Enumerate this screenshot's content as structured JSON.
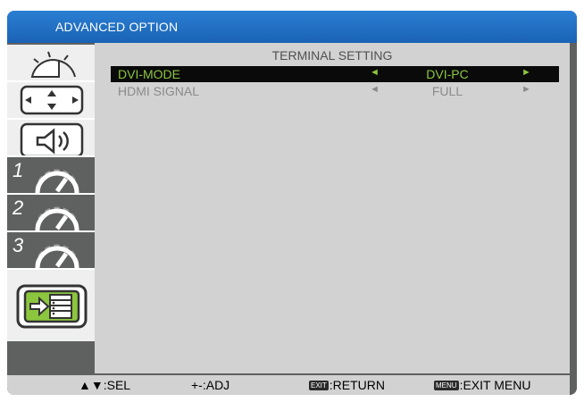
{
  "window": {
    "title": "ADVANCED OPTION"
  },
  "sidebar": {
    "items": [
      {
        "icon": "picture-icon"
      },
      {
        "icon": "screen-icon"
      },
      {
        "icon": "audio-icon"
      },
      {
        "icon": "config-1-icon",
        "number": "1"
      },
      {
        "icon": "config-2-icon",
        "number": "2"
      },
      {
        "icon": "config-3-icon",
        "number": "3"
      },
      {
        "icon": "advanced-option-icon",
        "selected": true
      }
    ]
  },
  "content": {
    "section_title": "TERMINAL SETTING",
    "rows": [
      {
        "label": "DVI-MODE",
        "value": "DVI-PC",
        "left_arrow": "◄",
        "right_arrow": "►",
        "selected": true
      },
      {
        "label": "HDMI SIGNAL",
        "value": "FULL",
        "left_arrow": "◄",
        "right_arrow": "►",
        "selected": false
      }
    ]
  },
  "footer": {
    "sel_text": "▲▼:SEL",
    "adj_text": "+-:ADJ",
    "exit_badge": "EXIT",
    "return_text": ":RETURN",
    "menu_badge": "MENU",
    "exit_menu_text": ":EXIT MENU"
  },
  "colors": {
    "title_bar": "#1a62b5",
    "selected_text": "#8cc63e",
    "panel_bg": "#d2d2d2",
    "frame": "#5f6060"
  }
}
